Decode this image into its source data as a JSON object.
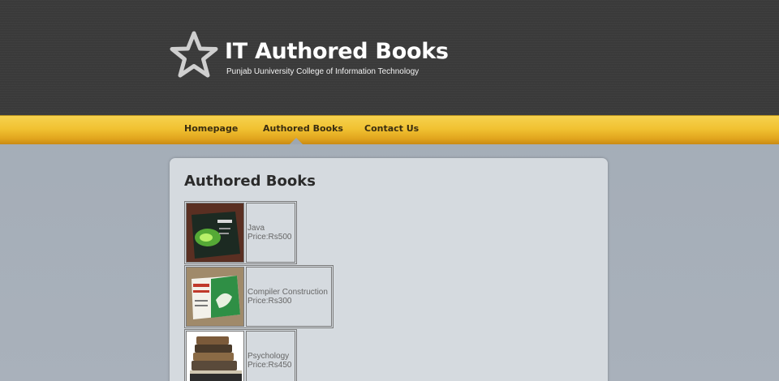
{
  "header": {
    "title": "IT Authored Books",
    "subtitle": "Punjab Uuniversity College of Information Technology",
    "logo_icon": "star-icon"
  },
  "nav": {
    "items": [
      {
        "label": "Homepage"
      },
      {
        "label": "Authored Books"
      },
      {
        "label": "Contact Us"
      }
    ],
    "active": "Authored Books"
  },
  "content": {
    "title": "Authored Books",
    "books": [
      {
        "name": "Java",
        "price": "Price:Rs500",
        "cover": "java-cover"
      },
      {
        "name": "Compiler Construction",
        "price": "Price:Rs300",
        "cover": "compiler-cover"
      },
      {
        "name": "Psychology",
        "price": "Price:Rs450",
        "cover": "psychology-cover"
      }
    ]
  },
  "colors": {
    "header_bg": "#3a3a3a",
    "nav_bg": "#f1c232",
    "panel_bg": "#d5dadf"
  }
}
